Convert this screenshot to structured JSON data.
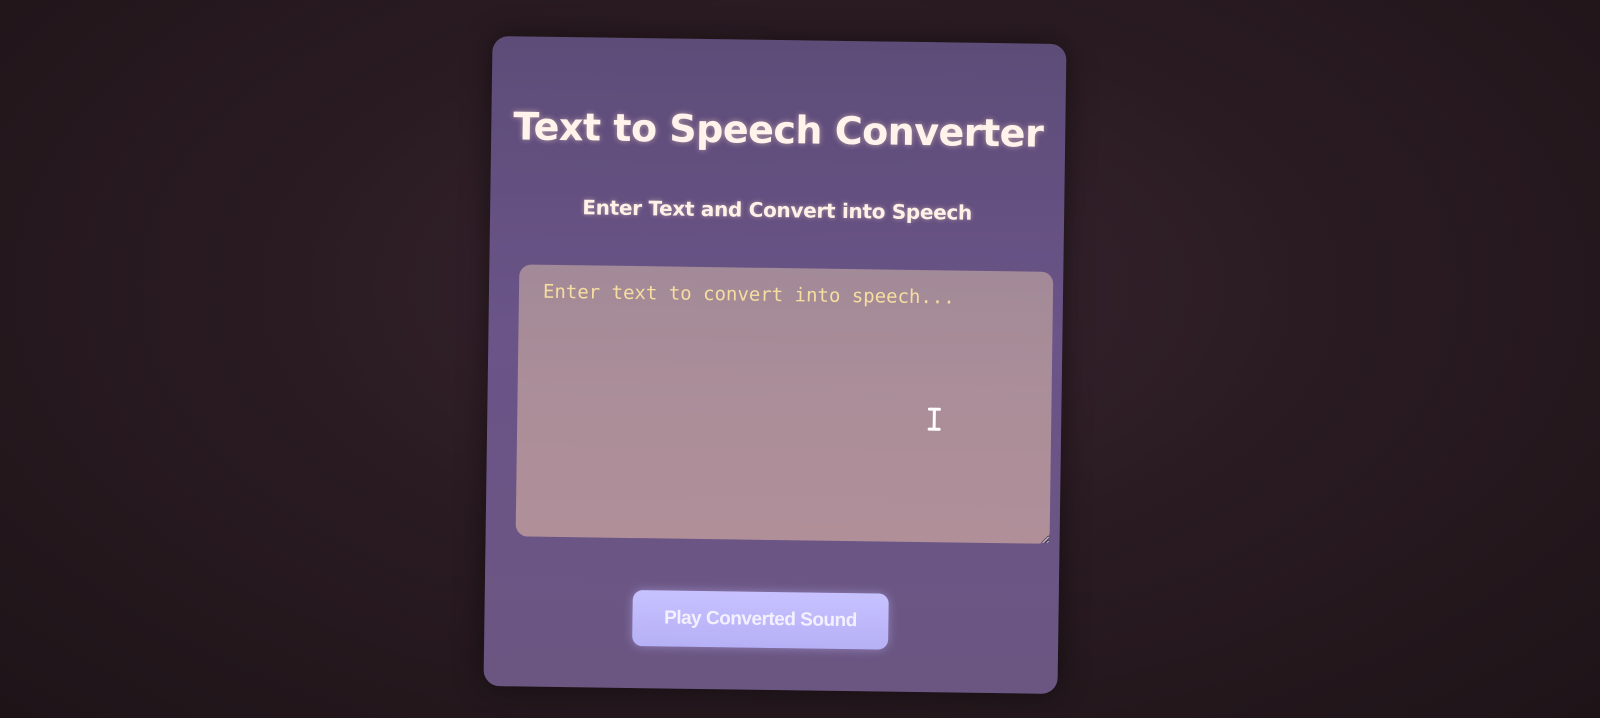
{
  "app": {
    "title": "Text to Speech Converter",
    "subtitle": "Enter Text and Convert into Speech"
  },
  "input": {
    "value": "",
    "placeholder": "Enter text to convert into speech..."
  },
  "actions": {
    "play_label": "Play Converted Sound"
  },
  "icons": {
    "cursor": "text-cursor-icon"
  },
  "colors": {
    "card": "#6a5488",
    "textarea": "#ab8e99",
    "placeholder": "#f7dea0",
    "button": "#c0baff",
    "background": "#2a1b22"
  }
}
